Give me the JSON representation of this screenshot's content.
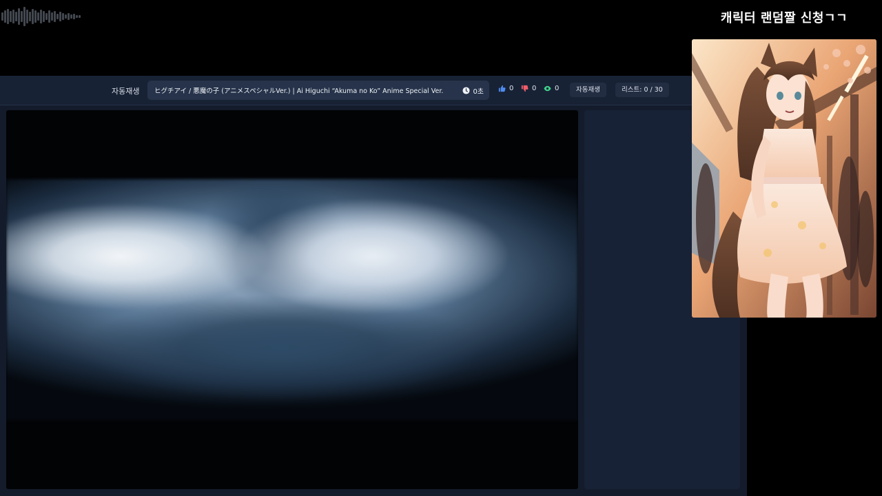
{
  "overlay": {
    "title": "캐릭터 랜덤짤 신청ㄱㄱ"
  },
  "toolbar": {
    "autoplay_label": "자동재생",
    "now_playing": {
      "title": "ヒグチアイ / 悪魔の子 (アニメスペシャルVer.) | Ai Higuchi “Akuma no Ko” Anime Special Ver.",
      "time": "0초"
    },
    "likes": "0",
    "dislikes": "0",
    "views": "0",
    "autoplay_button": "자동재생",
    "playlist_count": "리스트: 0 / 30"
  },
  "icons": {
    "clock": "clock-icon",
    "like": "thumbs-up-icon",
    "dislike": "thumbs-down-icon",
    "views": "eye-icon"
  },
  "colors": {
    "background": "#000000",
    "app": "#141c2b",
    "toolbar": "#182235",
    "like": "#4f8cf0",
    "dislike": "#ef5d6b",
    "views": "#3fd18b"
  }
}
